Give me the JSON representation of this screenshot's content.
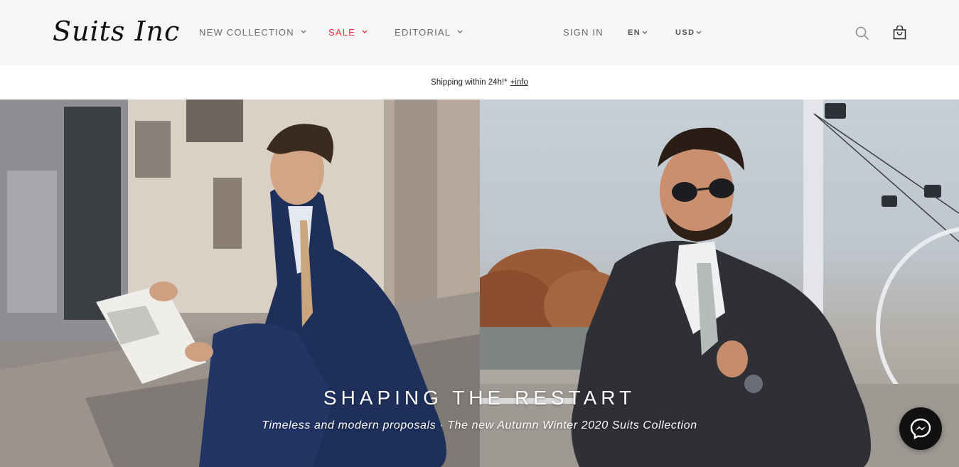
{
  "header": {
    "logo": "Suits Inc",
    "nav": [
      {
        "label": "NEW COLLECTION"
      },
      {
        "label": "SALE",
        "color": "#e8303a"
      },
      {
        "label": "EDITORIAL"
      }
    ],
    "sign_in": "SIGN IN",
    "language": "EN",
    "currency": "USD",
    "icons": [
      "search-icon",
      "shopping-bag-icon"
    ]
  },
  "shipping_bar": {
    "text": "Shipping within 24h!*",
    "link": "+info"
  },
  "hero": {
    "title": "SHAPING THE RESTART",
    "subtitle": "Timeless and modern proposals · The new Autumn Winter 2020 Suits Collection",
    "left_image": "man-in-navy-suit-reading-newspaper",
    "right_image": "man-in-grey-suit-with-sunglasses"
  },
  "chat": {
    "icon": "messenger-icon"
  },
  "colors": {
    "header_bg": "#f6f6f6",
    "accent_sale": "#e8303a",
    "text_nav": "#6b6b6b"
  }
}
